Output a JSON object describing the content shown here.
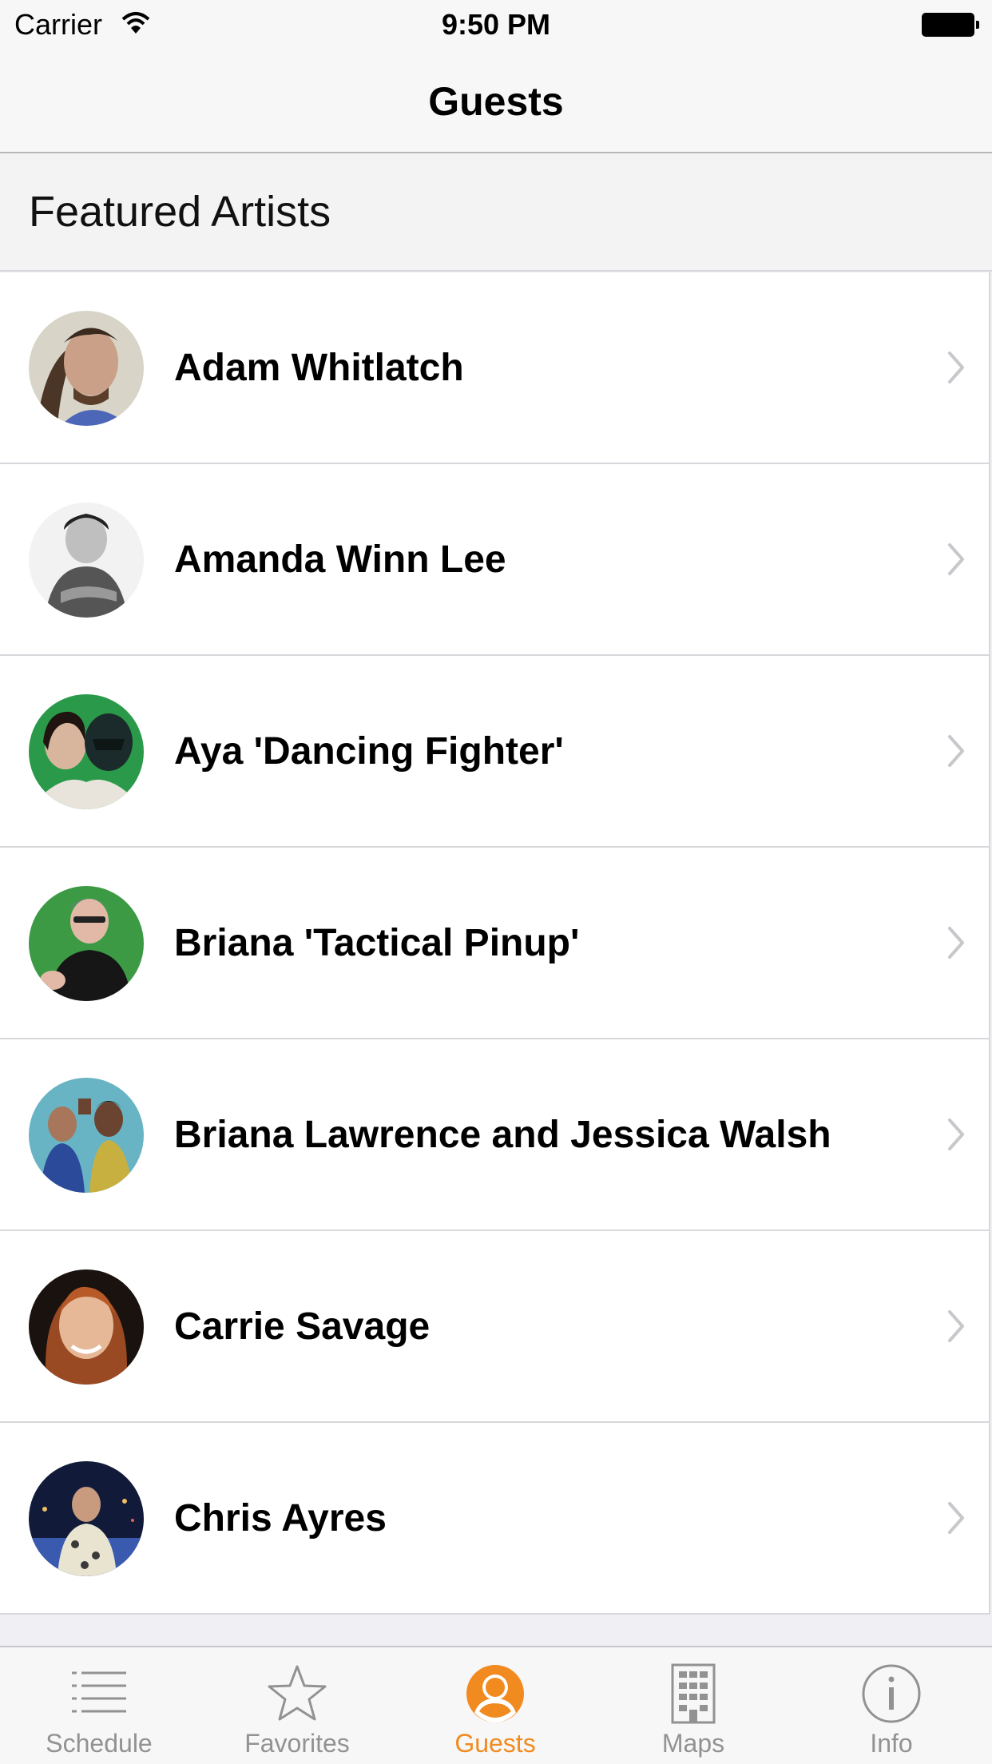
{
  "status_bar": {
    "carrier": "Carrier",
    "time": "9:50 PM"
  },
  "nav": {
    "title": "Guests"
  },
  "section": {
    "title": "Featured Artists"
  },
  "guests": [
    {
      "name": "Adam Whitlatch"
    },
    {
      "name": "Amanda Winn Lee"
    },
    {
      "name": "Aya 'Dancing Fighter'"
    },
    {
      "name": "Briana 'Tactical Pinup'"
    },
    {
      "name": "Briana Lawrence and Jessica Walsh"
    },
    {
      "name": "Carrie Savage"
    },
    {
      "name": "Chris Ayres"
    }
  ],
  "tabs": [
    {
      "label": "Schedule",
      "icon": "list-icon",
      "active": false
    },
    {
      "label": "Favorites",
      "icon": "star-icon",
      "active": false
    },
    {
      "label": "Guests",
      "icon": "person-icon",
      "active": true
    },
    {
      "label": "Maps",
      "icon": "building-icon",
      "active": false
    },
    {
      "label": "Info",
      "icon": "info-icon",
      "active": false
    }
  ],
  "colors": {
    "accent": "#f18a1f",
    "inactive_tab": "#929292"
  }
}
